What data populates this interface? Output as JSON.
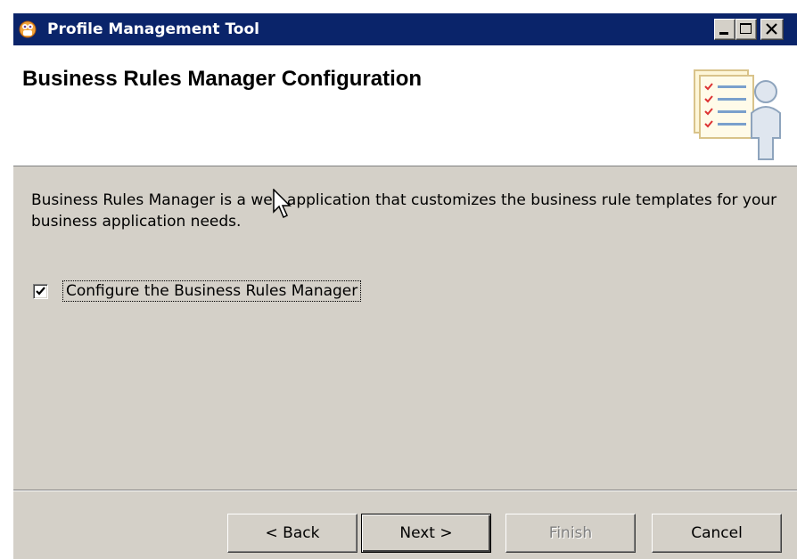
{
  "window": {
    "title": "Profile Management Tool"
  },
  "header": {
    "title": "Business Rules Manager Configuration"
  },
  "main": {
    "description": "Business Rules Manager is a web application that customizes the business rule templates for your business application needs.",
    "checkbox": {
      "label": "Configure the Business Rules Manager",
      "checked": true
    }
  },
  "footer": {
    "back_label": "< Back",
    "next_label": "Next >",
    "finish_label": "Finish",
    "cancel_label": "Cancel"
  },
  "colors": {
    "titlebar": "#0a246a",
    "face": "#d4d0c8",
    "disabled_text": "#808080"
  },
  "icons": {
    "app": "profile-tool-icon",
    "minimize": "minimize-icon",
    "maximize": "maximize-icon",
    "close": "close-icon",
    "header": "checklist-person-icon",
    "checkmark": "checkmark-icon",
    "pointer": "mouse-cursor-icon"
  }
}
